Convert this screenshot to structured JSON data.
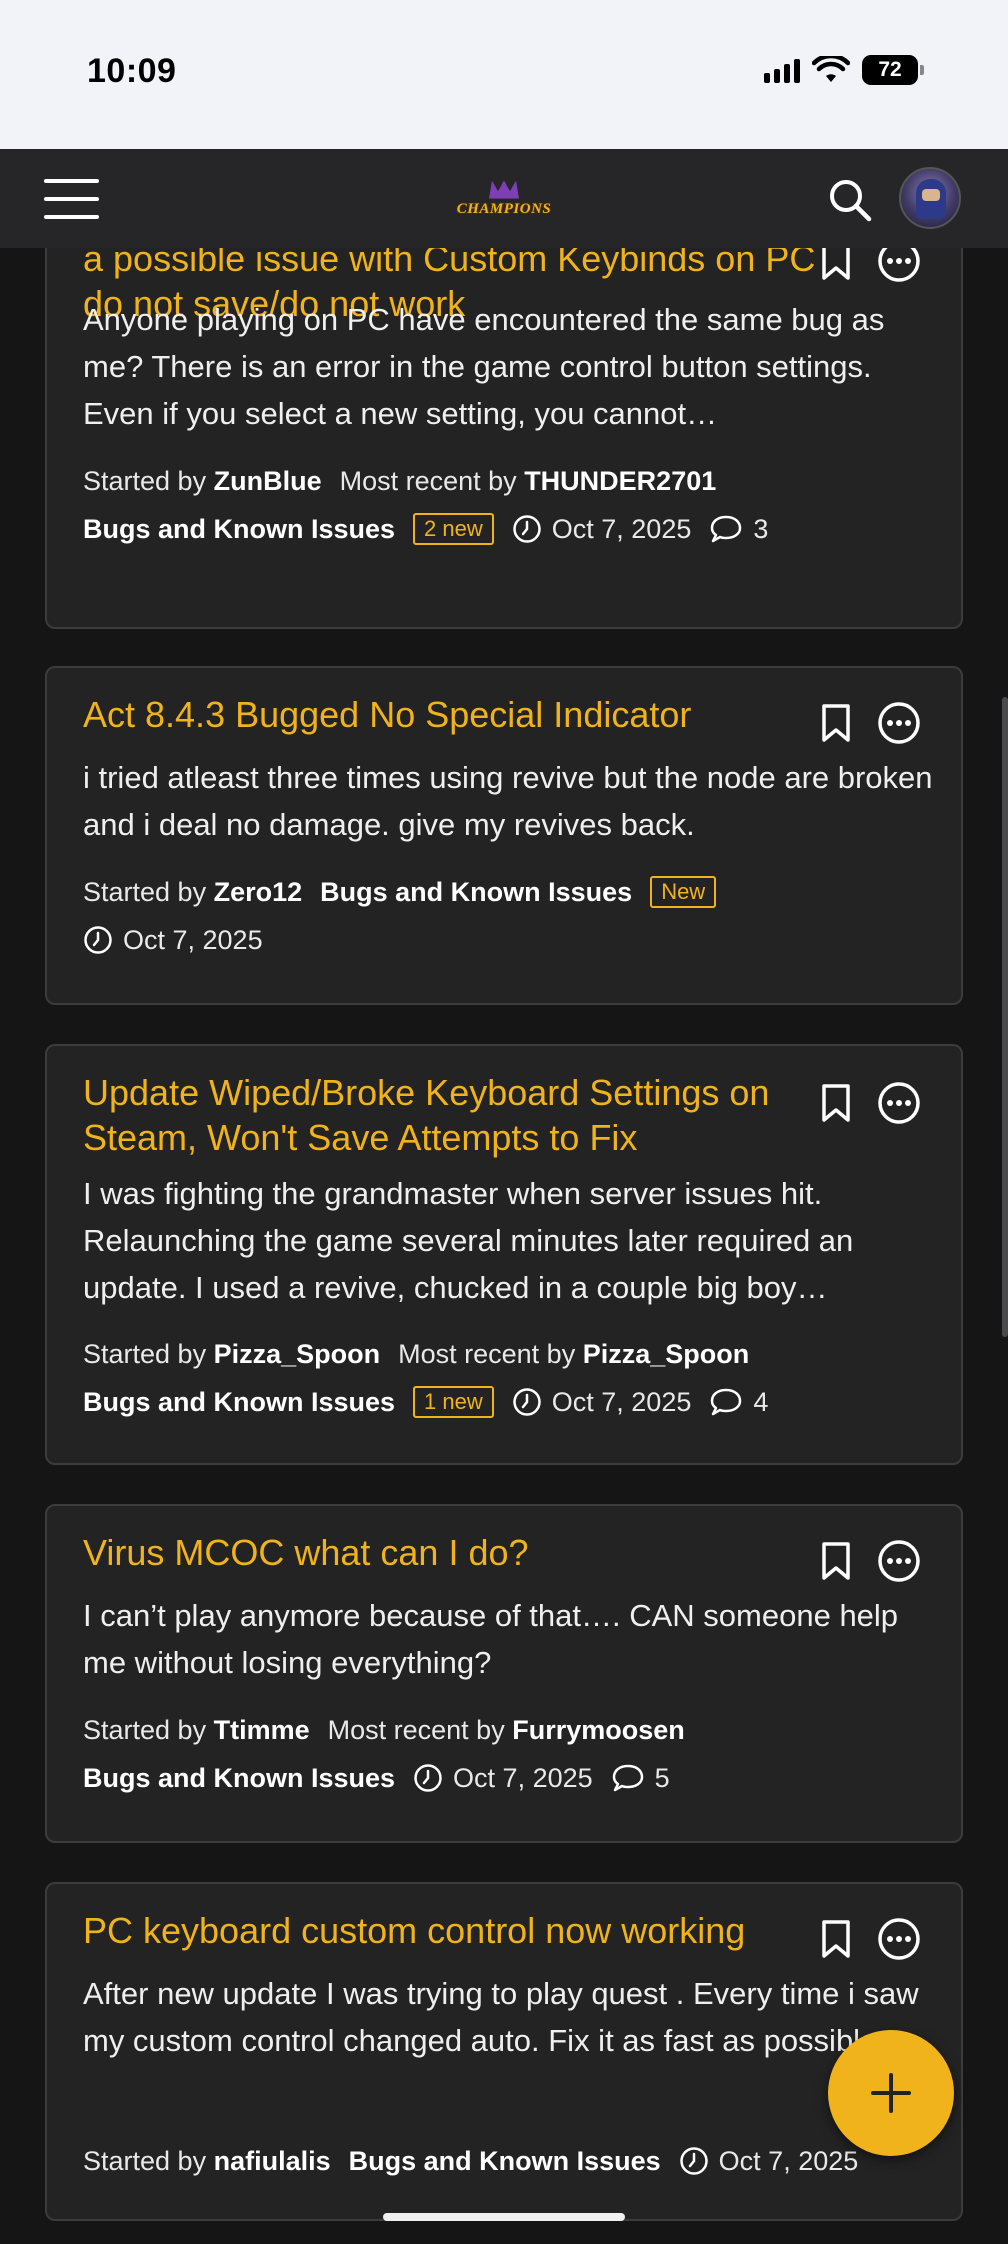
{
  "status_bar": {
    "time": "10:09",
    "battery": "72"
  },
  "header": {
    "logo_text": "CHAMPIONS"
  },
  "discussions": [
    {
      "title": "a possible issue with Custom Keybinds on PC do not save/do not work",
      "excerpt": "Anyone playing on PC have encountered the same bug as me? There is an error in the game control button settings. Even if you select a new setting, you cannot…",
      "started_by_label": "Started by",
      "author": "ZunBlue",
      "recent_label": "Most recent by",
      "recent_author": "THUNDER2701",
      "category": "Bugs and Known Issues",
      "badge": "2 new",
      "date": "Oct 7, 2025",
      "comments": "3"
    },
    {
      "title": "Act 8.4.3 Bugged No Special Indicator",
      "excerpt": "i tried atleast three times using revive but the node are broken and i deal no damage. give my revives back.",
      "started_by_label": "Started by",
      "author": "Zero12",
      "category": "Bugs and Known Issues",
      "badge": "New",
      "date": "Oct 7, 2025"
    },
    {
      "title": "Update Wiped/Broke Keyboard Settings on Steam, Won't Save Attempts to Fix",
      "excerpt": "I was fighting the grandmaster when server issues hit. Relaunching the game several minutes later required an update. I used a revive, chucked in a couple big boy…",
      "started_by_label": "Started by",
      "author": "Pizza_Spoon",
      "recent_label": "Most recent by",
      "recent_author": "Pizza_Spoon",
      "category": "Bugs and Known Issues",
      "badge": "1 new",
      "date": "Oct 7, 2025",
      "comments": "4"
    },
    {
      "title": "Virus MCOC what can I do?",
      "excerpt": "I can’t play anymore because of that…. CAN someone help me without losing everything?",
      "started_by_label": "Started by",
      "author": "Ttimme",
      "recent_label": "Most recent by",
      "recent_author": "Furrymoosen",
      "category": "Bugs and Known Issues",
      "date": "Oct 7, 2025",
      "comments": "5"
    },
    {
      "title": "PC keyboard custom control now working",
      "excerpt": "After new update I was trying to play quest . Every time i saw my custom control changed auto. Fix it as fast as possible.",
      "started_by_label": "Started by",
      "author": "nafiulalis",
      "category": "Bugs and Known Issues",
      "date": "Oct 7, 2025"
    }
  ],
  "colors": {
    "accent": "#f0b31c",
    "card_bg": "#232324",
    "page_bg": "#151516"
  }
}
